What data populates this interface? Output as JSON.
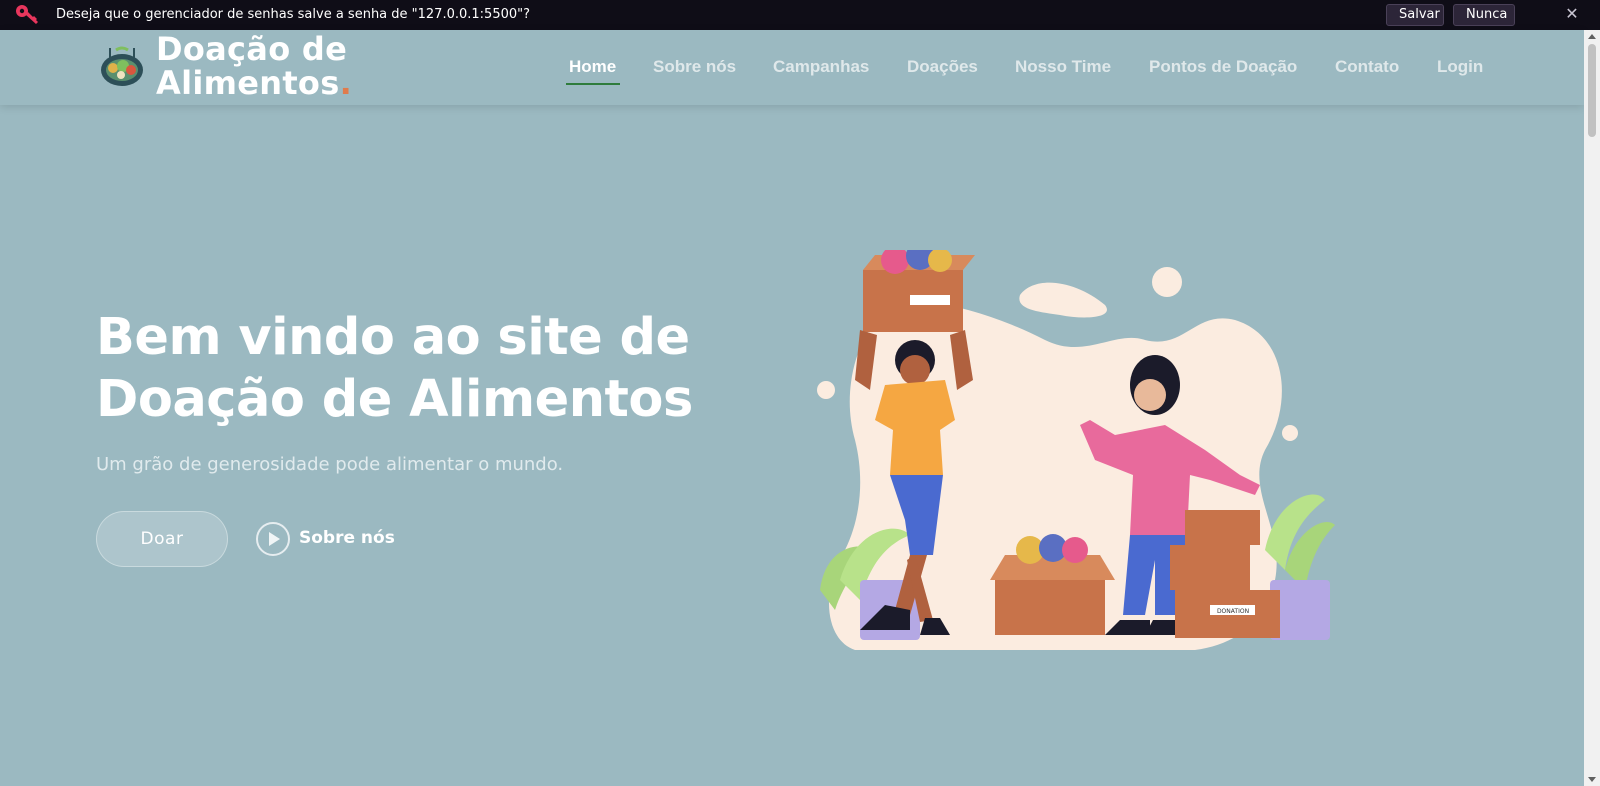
{
  "password_bar": {
    "icon": "key-icon",
    "message": "Deseja que o gerenciador de senhas salve a senha de \"127.0.0.1:5500\"?",
    "save_label": "Salvar",
    "never_label": "Nunca",
    "close_icon": "close-icon"
  },
  "header": {
    "brand_line1": "Doação de",
    "brand_line2": "Alimentos",
    "brand_dot": ".",
    "nav": [
      {
        "label": "Home",
        "active": true
      },
      {
        "label": "Sobre nós"
      },
      {
        "label": "Campanhas"
      },
      {
        "label": "Doações"
      },
      {
        "label": "Nosso Time"
      },
      {
        "label": "Pontos de Doação"
      },
      {
        "label": "Contato"
      },
      {
        "label": "Login"
      }
    ]
  },
  "hero": {
    "title_line1": "Bem vindo ao site de",
    "title_line2": "Doação de Alimentos",
    "subtitle": "Um grão de generosidade pode alimentar o mundo.",
    "donate_button": "Doar",
    "about_link": "Sobre nós",
    "illustration_label": "DONATION"
  },
  "colors": {
    "background": "#9bb9c1",
    "accent": "#e07b4c",
    "nav_active_underline": "#2f7c3c"
  }
}
